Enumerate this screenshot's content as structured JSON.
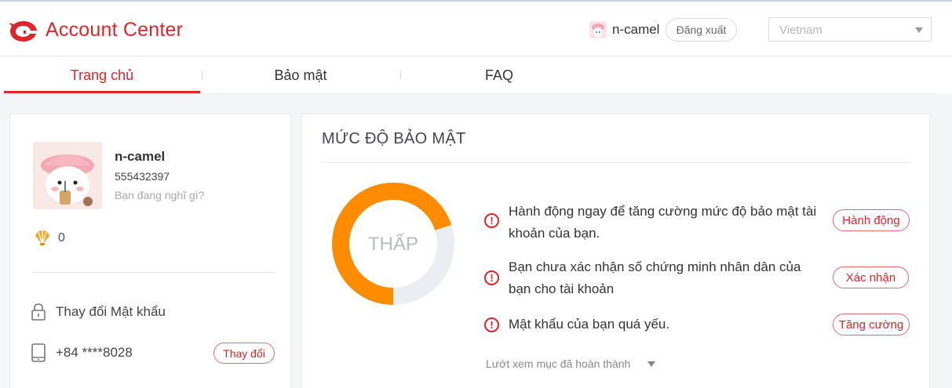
{
  "header": {
    "brand": "Account Center",
    "username": "n-camel",
    "logout_label": "Đăng xuất",
    "region": "Vietnam"
  },
  "tabs": [
    {
      "label": "Trang chủ",
      "active": true
    },
    {
      "label": "Bảo mật",
      "active": false
    },
    {
      "label": "FAQ",
      "active": false
    }
  ],
  "profile": {
    "name": "n-camel",
    "id": "555432397",
    "bio_placeholder": "Bạn đang nghĩ gì?",
    "shells": "0",
    "password_label": "Thay đổi Mật khẩu",
    "phone": "+84 ****8028",
    "change_label": "Thay đổi"
  },
  "security": {
    "title": "MỨC ĐỘ BẢO MẬT",
    "level": "THẤP",
    "level_fraction": 0.3,
    "issues": [
      {
        "text": "Hành động ngay để tăng cường mức độ bảo mật tài khoản của bạn.",
        "action": "Hành động"
      },
      {
        "text": "Bạn chưa xác nhận số chứng minh nhân dân của bạn cho tài khoản",
        "action": "Xác nhận"
      },
      {
        "text": "Mật khẩu của bạn quá yếu.",
        "action": "Tăng cường"
      }
    ],
    "see_completed": "Lướt xem mục đã hoàn thành"
  },
  "colors": {
    "brand": "#e0242b",
    "gauge": "#ff8c00",
    "gauge_track": "#eaeef2"
  },
  "icons": {
    "logo": "garena-logo-icon",
    "shell": "shell-icon",
    "lock": "lock-icon",
    "phone": "phone-icon",
    "warning": "warning-icon"
  }
}
